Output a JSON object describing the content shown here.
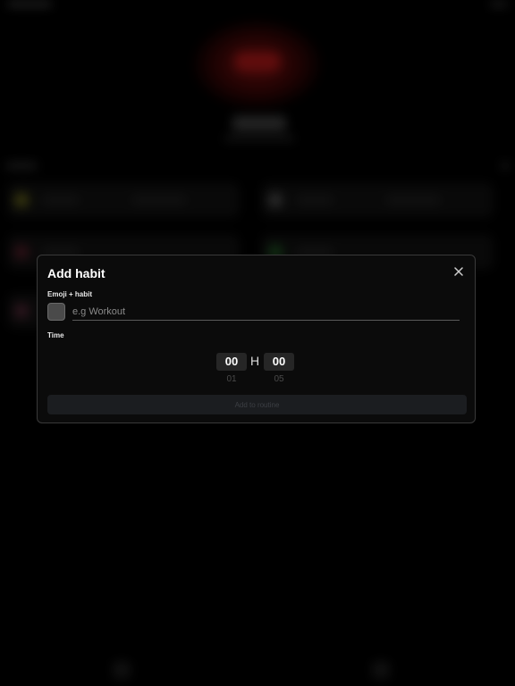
{
  "modal": {
    "title": "Add habit",
    "emoji_habit_label": "Emoji + habit",
    "habit_placeholder": "e.g Workout",
    "habit_value": "",
    "time_label": "Time",
    "hours": "00",
    "hour_separator": "H",
    "minutes": "00",
    "next_hours": "01",
    "next_minutes": "05",
    "add_button_label": "Add to routine"
  },
  "icons": {
    "close": "close-icon"
  },
  "colors": {
    "background": "#000000",
    "modal_background": "#0b0b0b",
    "modal_border": "#3a3a3a",
    "accent_glow": "#b01818",
    "button_disabled": "#1b1d20"
  }
}
